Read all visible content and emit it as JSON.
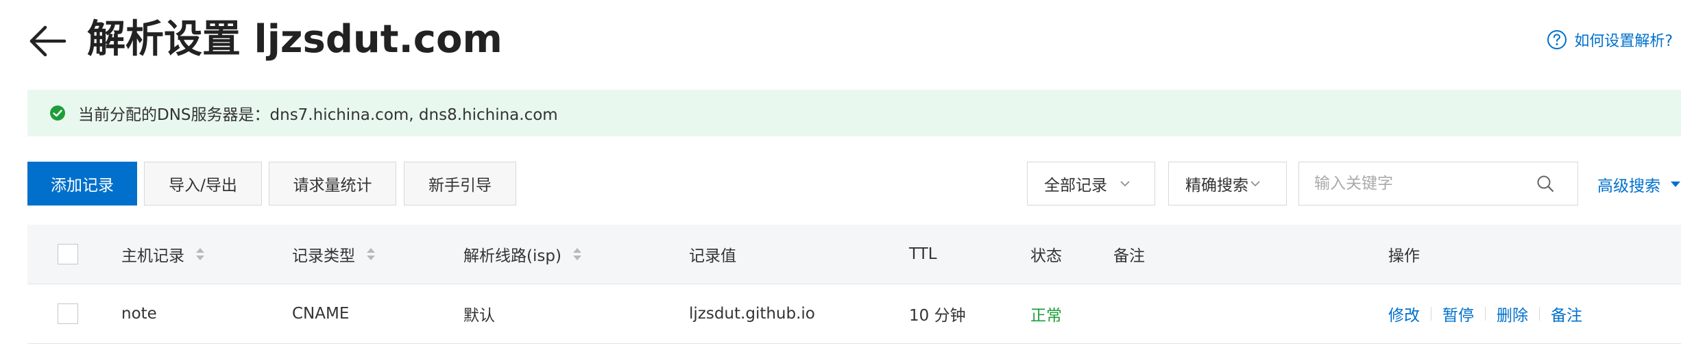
{
  "header": {
    "title": "解析设置 ljzsdut.com",
    "help_link": "如何设置解析?"
  },
  "dns_notice": {
    "text": "当前分配的DNS服务器是：dns7.hichina.com, dns8.hichina.com",
    "status_color": "#1e9e3a"
  },
  "toolbar": {
    "add_record": "添加记录",
    "import_export": "导入/导出",
    "request_stats": "请求量统计",
    "beginner_guide": "新手引导",
    "record_filter": "全部记录",
    "search_mode": "精确搜索",
    "search_placeholder": "输入关键字",
    "search_value": "",
    "advanced_search": "高级搜索"
  },
  "table": {
    "columns": {
      "host": "主机记录",
      "type": "记录类型",
      "line": "解析线路(isp)",
      "value": "记录值",
      "ttl": "TTL",
      "status": "状态",
      "remark": "备注",
      "actions": "操作"
    },
    "rows": [
      {
        "host": "note",
        "type": "CNAME",
        "line": "默认",
        "value": "ljzsdut.github.io",
        "ttl": "10 分钟",
        "status": "正常",
        "remark": "",
        "actions": {
          "edit": "修改",
          "pause": "暂停",
          "delete": "删除",
          "remark": "备注"
        }
      }
    ]
  },
  "colors": {
    "accent": "#0070cc",
    "success": "#1e9e3a",
    "notice_bg": "#e9f8ee",
    "header_bg": "#f5f6f7"
  },
  "icons": {
    "back": "arrow-left-icon",
    "help": "question-circle-icon",
    "status": "check-circle-icon",
    "search": "search-icon",
    "dropdown": "chevron-down-icon",
    "sort": "sort-icon",
    "caret": "caret-down-icon"
  }
}
